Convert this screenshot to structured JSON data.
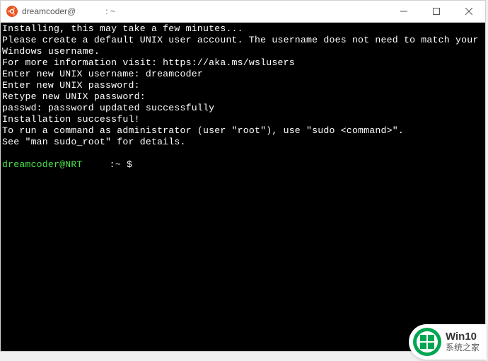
{
  "titlebar": {
    "title": "dreamcoder@",
    "title_suffix": ": ~"
  },
  "terminal": {
    "lines": [
      "Installing, this may take a few minutes...",
      "Please create a default UNIX user account. The username does not need to match your",
      "Windows username.",
      "For more information visit: https://aka.ms/wslusers",
      "Enter new UNIX username: dreamcoder",
      "Enter new UNIX password:",
      "Retype new UNIX password:",
      "passwd: password updated successfully",
      "Installation successful!",
      "To run a command as administrator (user \"root\"), use \"sudo <command>\".",
      "See \"man sudo_root\" for details."
    ],
    "prompt": {
      "user_host": "dreamcoder@NRT",
      "path": ":~",
      "dollar": "$"
    }
  },
  "watermark": {
    "top": "Win10",
    "bottom": "系统之家"
  }
}
